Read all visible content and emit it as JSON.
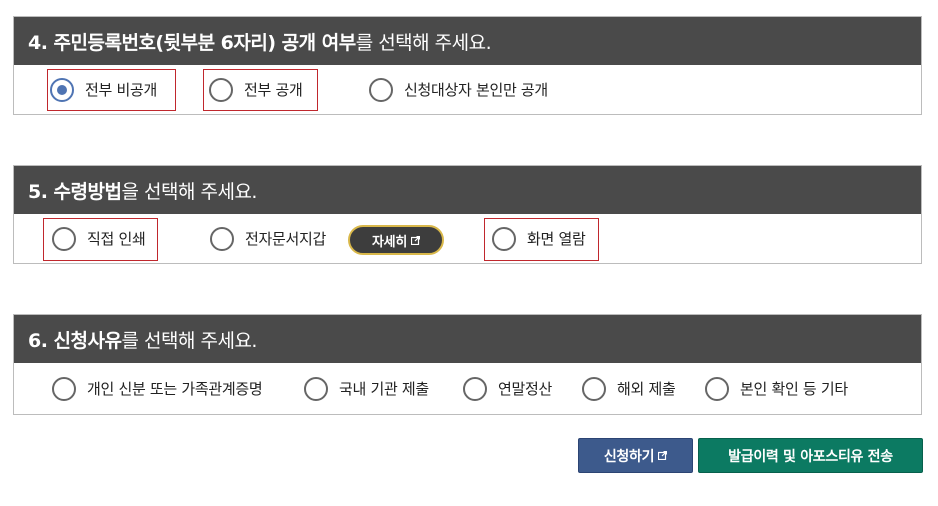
{
  "sections": [
    {
      "header_bold": "4. 주민등록번호(뒷부분 6자리) 공개 여부",
      "header_rest": "를 선택해 주세요.",
      "options": [
        {
          "label": "전부 비공개",
          "checked": true,
          "highlighted": true
        },
        {
          "label": "전부 공개",
          "checked": false,
          "highlighted": true
        },
        {
          "label": "신청대상자 본인만 공개",
          "checked": false,
          "highlighted": false
        }
      ]
    },
    {
      "header_bold": "5. 수령방법",
      "header_rest": "을 선택해 주세요.",
      "options": [
        {
          "label": "직접 인쇄",
          "checked": false,
          "highlighted": true
        },
        {
          "label": "전자문서지갑",
          "checked": false,
          "highlighted": false
        },
        {
          "label": "화면 열람",
          "checked": false,
          "highlighted": true
        }
      ],
      "detail_button": "자세히"
    },
    {
      "header_bold": "6. 신청사유",
      "header_rest": "를 선택해 주세요.",
      "options": [
        {
          "label": "개인 신분 또는 가족관계증명",
          "checked": false
        },
        {
          "label": "국내 기관 제출",
          "checked": false
        },
        {
          "label": "연말정산",
          "checked": false
        },
        {
          "label": "해외 제출",
          "checked": false
        },
        {
          "label": "본인 확인 등 기타",
          "checked": false
        }
      ]
    }
  ],
  "buttons": {
    "apply": "신청하기",
    "history": "발급이력 및 아포스티유 전송"
  },
  "colors": {
    "header_bg": "#4a4a4a",
    "radio_checked": "#4f74b3",
    "highlight_border": "#c0272d",
    "apply_button": "#3d5a8c",
    "history_button": "#0c7a62",
    "detail_button_border": "#d9b84a"
  }
}
